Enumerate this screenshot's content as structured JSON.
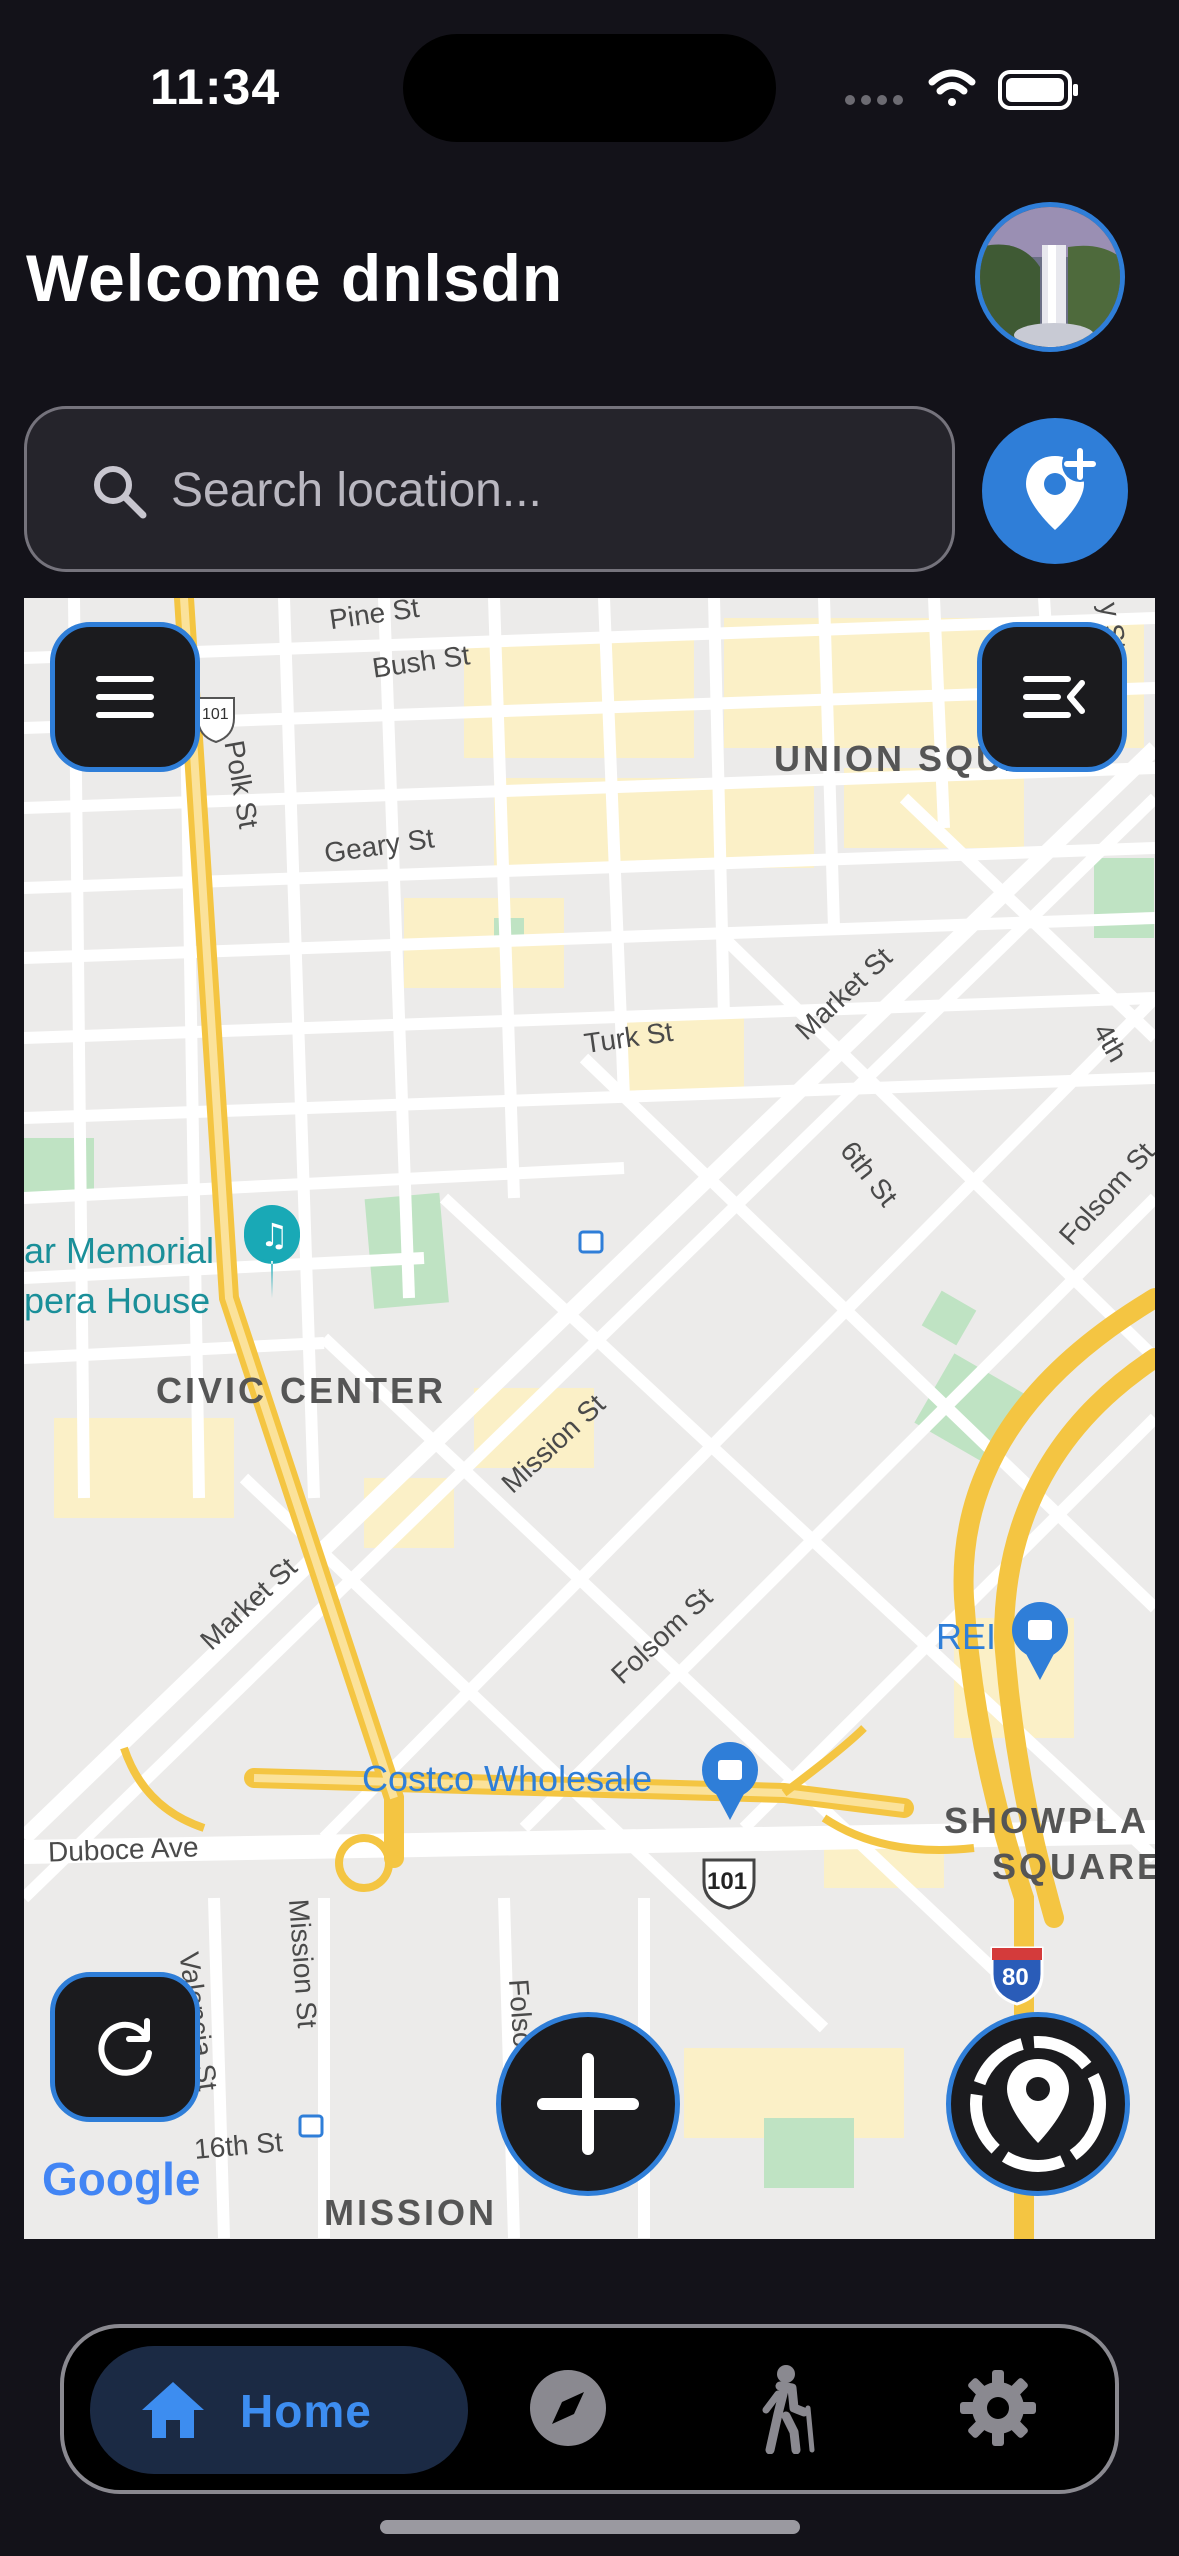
{
  "status_bar": {
    "time": "11:34"
  },
  "header": {
    "welcome": "Welcome dnlsdn"
  },
  "search": {
    "placeholder": "Search location..."
  },
  "map": {
    "streets": [
      "Pine St",
      "Bush St",
      "Polk St",
      "Geary St",
      "Turk St",
      "Market St",
      "6th St",
      "Folsom St",
      "Mission St",
      "Market St",
      "Folsom St",
      "Duboce Ave",
      "Mission St",
      "Valencia St",
      "Folsom St",
      "16th St",
      "4th",
      "y St"
    ],
    "districts": [
      "UNION SQUARE",
      "CIVIC CENTER",
      "SHOWPLA",
      "SQUARE",
      "MISSION"
    ],
    "pois": [
      "ar Memorial",
      "pera House",
      "Costco Wholesale",
      "REI"
    ],
    "shields": [
      "101",
      "101",
      "80"
    ],
    "attribution": "Google"
  },
  "nav": {
    "items": [
      {
        "label": "Home"
      }
    ]
  },
  "colors": {
    "accent": "#2f7ed8",
    "background": "#131219",
    "nav_active": "#3d8df0"
  }
}
